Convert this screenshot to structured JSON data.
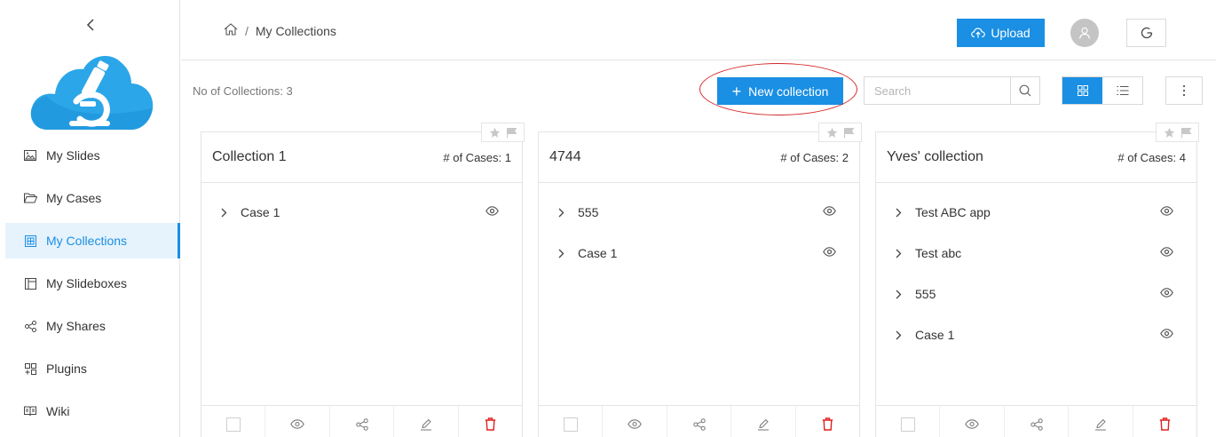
{
  "sidebar": {
    "items": [
      {
        "id": "slides",
        "label": "My Slides",
        "icon": "image-icon",
        "active": false
      },
      {
        "id": "cases",
        "label": "My Cases",
        "icon": "folder-open-icon",
        "active": false
      },
      {
        "id": "collections",
        "label": "My Collections",
        "icon": "collection-icon",
        "active": true
      },
      {
        "id": "slideboxes",
        "label": "My Slideboxes",
        "icon": "slidebox-icon",
        "active": false
      },
      {
        "id": "shares",
        "label": "My Shares",
        "icon": "share-icon",
        "active": false
      },
      {
        "id": "plugins",
        "label": "Plugins",
        "icon": "plugin-icon",
        "active": false
      },
      {
        "id": "wiki",
        "label": "Wiki",
        "icon": "book-icon",
        "active": false
      }
    ]
  },
  "header": {
    "breadcrumb": {
      "separator": "/",
      "current": "My Collections"
    },
    "upload_label": "Upload"
  },
  "toolbar": {
    "count_label": "No of Collections: 3",
    "new_collection_label": "New collection",
    "search_placeholder": "Search"
  },
  "colors": {
    "accent": "#1a8fe3",
    "danger": "#e02020",
    "annotation": "#d62828"
  },
  "collections": [
    {
      "title": "Collection 1",
      "count_label": "# of Cases: 1",
      "cases": [
        "Case 1"
      ]
    },
    {
      "title": "4744",
      "count_label": "# of Cases: 2",
      "cases": [
        "555",
        "Case 1"
      ]
    },
    {
      "title": "Yves' collection",
      "count_label": "# of Cases: 4",
      "cases": [
        "Test ABC app",
        "Test abc",
        "555",
        "Case 1"
      ]
    }
  ]
}
